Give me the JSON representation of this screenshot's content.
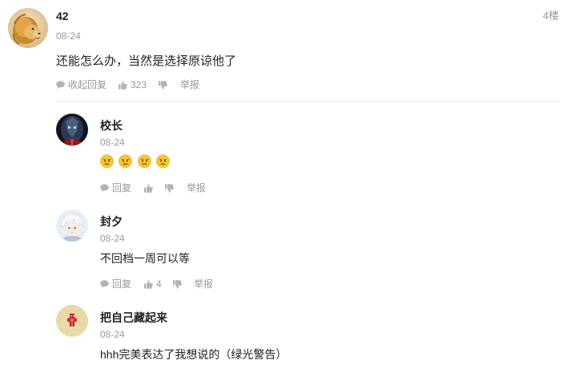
{
  "main_comment": {
    "username": "42",
    "date": "08-24",
    "floor": "4楼",
    "content": "还能怎么办，当然是选择原谅他了",
    "actions": {
      "reply_label": "收起回复",
      "like_count": "323",
      "report_label": "举报"
    }
  },
  "replies": [
    {
      "username": "校长",
      "date": "08-24",
      "emoji_name": "angry-emoji",
      "emoji_count": 4,
      "actions": {
        "reply_label": "回复",
        "like_count": "",
        "report_label": "举报"
      }
    },
    {
      "username": "封夕",
      "date": "08-24",
      "content": "不回档一周可以等",
      "actions": {
        "reply_label": "回复",
        "like_count": "4",
        "report_label": "举报"
      }
    },
    {
      "username": "把自己藏起来",
      "date": "08-24",
      "content": "hhh完美表达了我想说的（绿光警告）"
    }
  ],
  "colors": {
    "text_primary": "#222222",
    "text_secondary": "#999999",
    "divider": "#e8e8e8",
    "emoji_face": "#f7c531"
  }
}
